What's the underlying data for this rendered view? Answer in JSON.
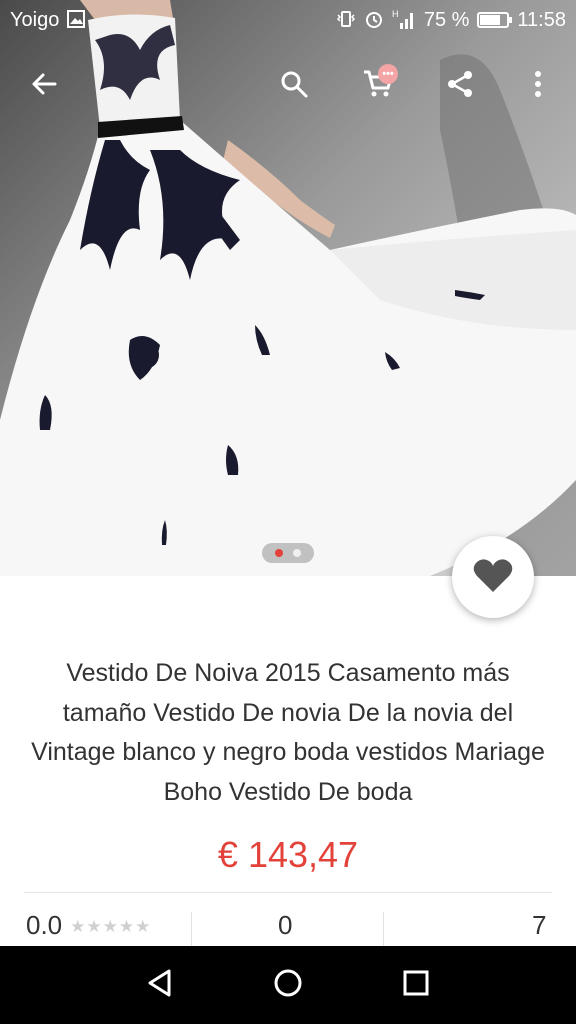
{
  "status_bar": {
    "carrier": "Yoigo",
    "battery_percent": "75 %",
    "time": "11:58",
    "battery_level": 0.75,
    "icons": [
      "photo-notification-icon",
      "vibrate-icon",
      "alarm-icon",
      "signal-icon",
      "battery-icon"
    ]
  },
  "toolbar": {
    "icons": [
      "back-arrow-icon",
      "search-icon",
      "cart-icon",
      "share-icon",
      "more-vert-icon"
    ],
    "cart_badge": "•••"
  },
  "gallery": {
    "active_page": 1,
    "page_count": 2,
    "dot_active_color": "#e3423a",
    "dot_inactive_color": "#f0f0f0"
  },
  "favorite": {
    "icon": "heart-icon",
    "color": "#555555"
  },
  "product": {
    "title": "Vestido De Noiva 2015 Casamento más tamaño Vestido De novia De la novia del Vintage blanco y negro boda vestidos Mariage Boho Vestido De boda",
    "price": "€ 143,47",
    "price_color": "#e3423a"
  },
  "stats": {
    "rating": "0.0",
    "stars": "★★★★★",
    "orders": "0",
    "wishlist": "7"
  },
  "nav_bar": {
    "icons": [
      "back-triangle-icon",
      "home-circle-icon",
      "recents-square-icon"
    ]
  }
}
